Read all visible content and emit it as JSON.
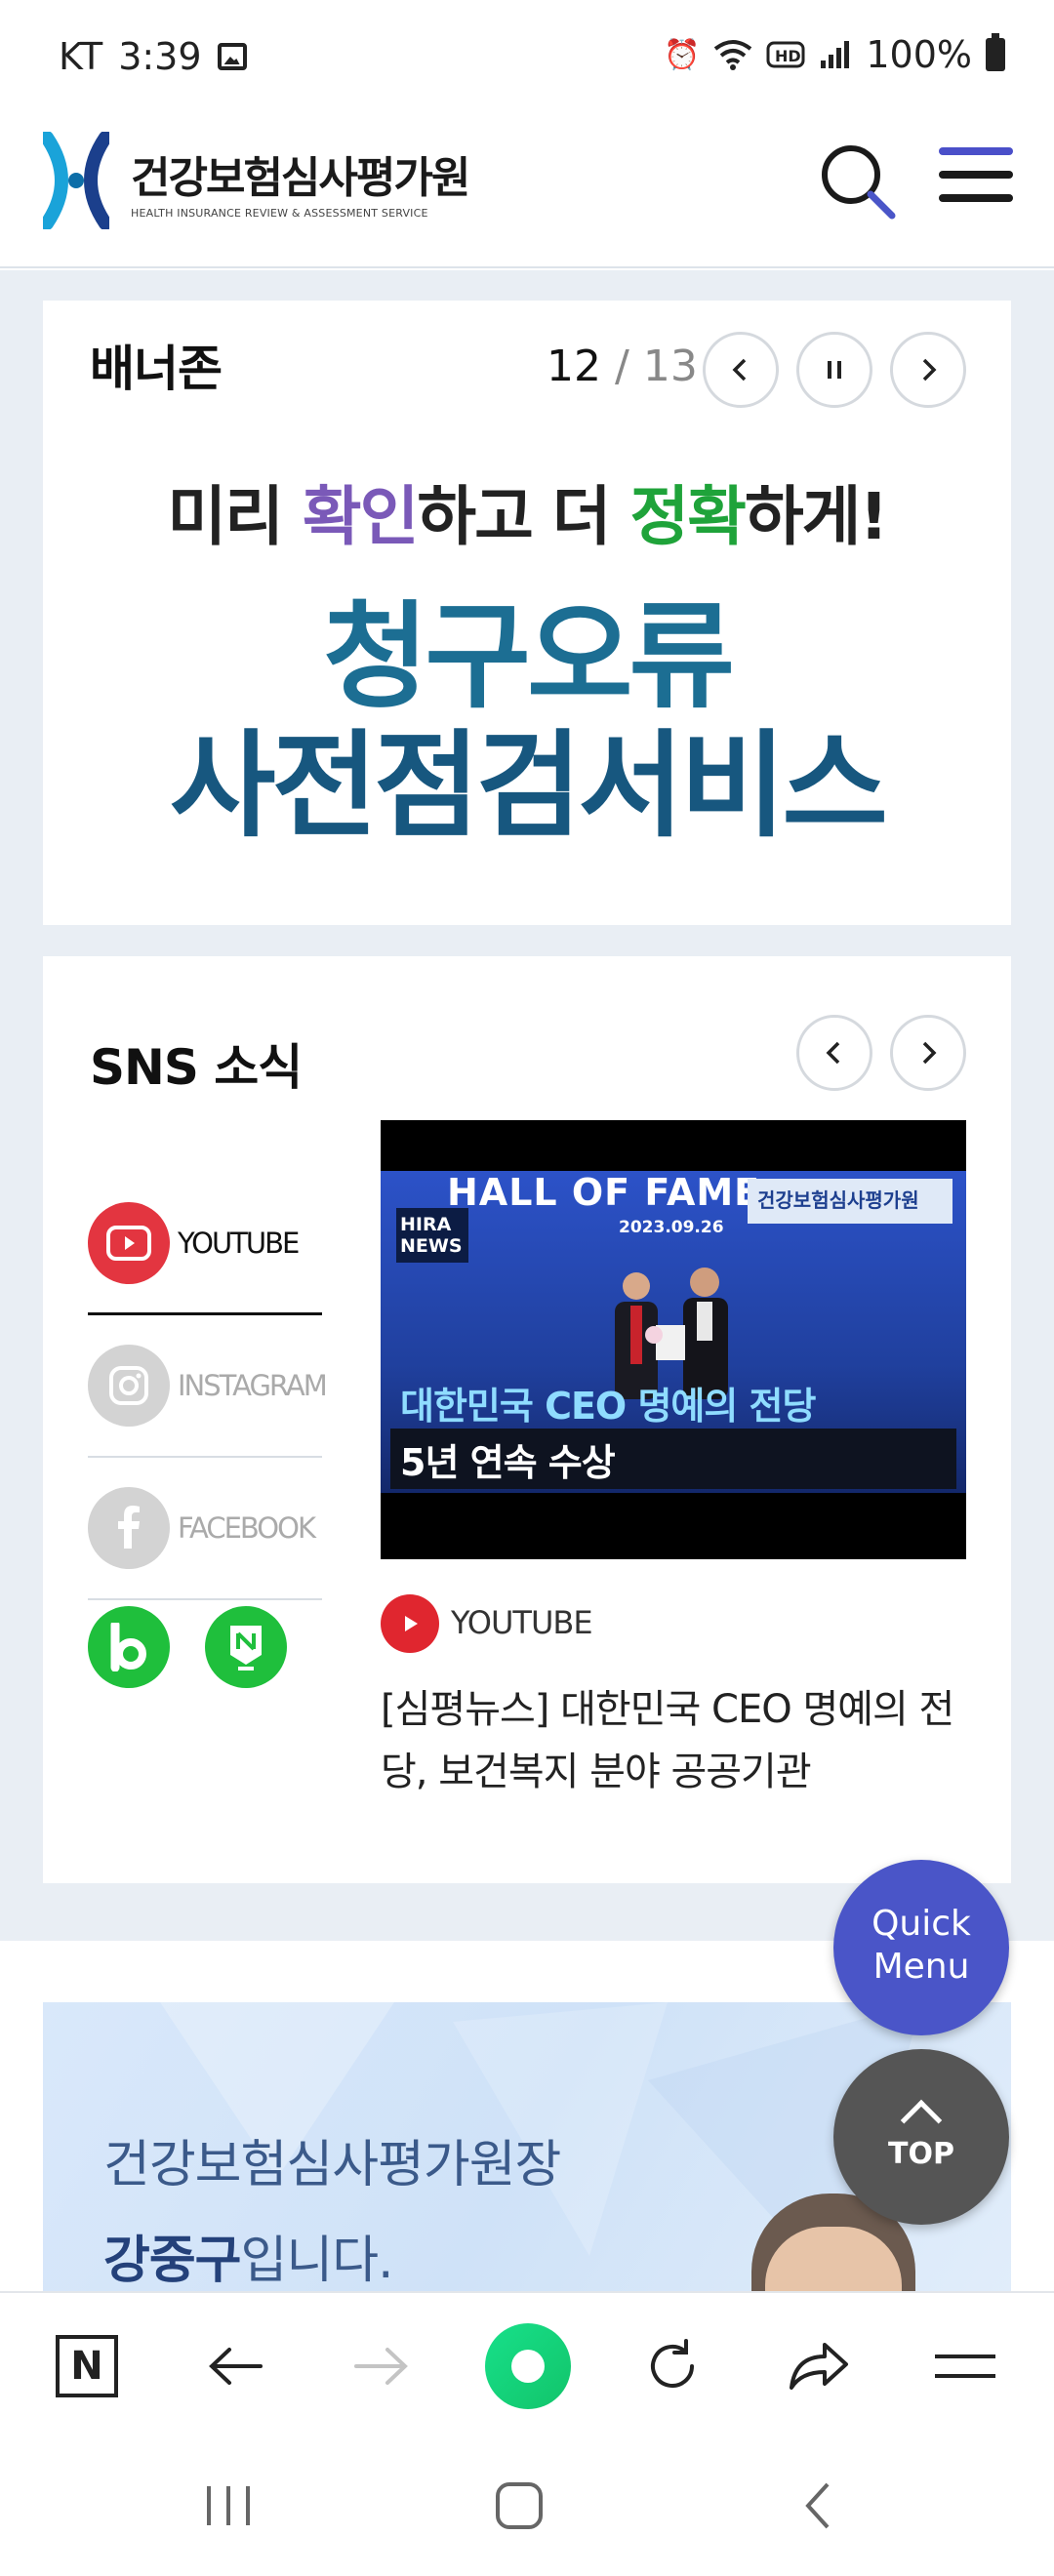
{
  "status_bar": {
    "carrier": "KT",
    "time": "3:39",
    "battery": "100%"
  },
  "header": {
    "logo_ko": "건강보험심사평가원",
    "logo_en": "HEALTH INSURANCE REVIEW & ASSESSMENT SERVICE"
  },
  "banner": {
    "title": "배너존",
    "current": "12",
    "separator": "/",
    "total": "13",
    "ad_line1_a": "미리 ",
    "ad_line1_b": "확인",
    "ad_line1_c": "하고 더 ",
    "ad_line1_d": "정확",
    "ad_line1_e": "하게!",
    "ad_line2": "청구오류",
    "ad_line3": "사전점검서비스"
  },
  "sns": {
    "title": "SNS 소식",
    "items": [
      {
        "label": "YOUTUBE"
      },
      {
        "label": "INSTAGRAM"
      },
      {
        "label": "FACEBOOK"
      }
    ],
    "video": {
      "hof": "HALL OF FAME",
      "date": "2023.09.26",
      "org": "건강보험심사평가원",
      "badge_1": "HIRA",
      "badge_2": "NEWS",
      "caption1": "대한민국 CEO 명예의 전당",
      "caption2": "5년 연속 수상"
    },
    "post_source": "YOUTUBE",
    "post_title": "[심평뉴스] 대한민국 CEO 명예의 전당, 보건복지 분야 공공기관"
  },
  "greeting": {
    "line1": "건강보험심사평가원장",
    "name": "강중구",
    "line2_suffix": "입니다."
  },
  "floating": {
    "quick_menu_1": "Quick",
    "quick_menu_2": "Menu",
    "top": "TOP"
  },
  "browser_toolbar": {
    "home_letter": "N"
  },
  "colors": {
    "accent": "#4a55c8",
    "youtube_red": "#e33540",
    "naver_green": "#1fbf3c",
    "banner_blue": "#1c6e93"
  }
}
